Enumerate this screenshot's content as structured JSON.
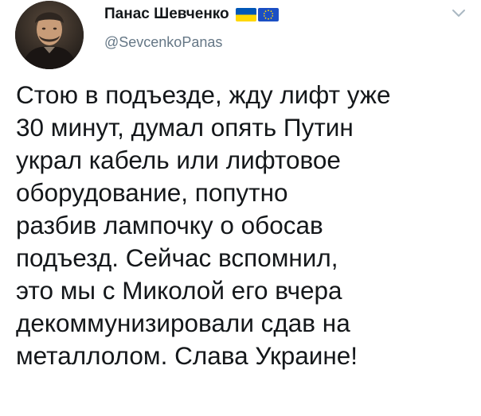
{
  "author": {
    "display_name": "Панас Шевченко",
    "handle": "@SevcenkoPanas",
    "flag_icons": [
      "ukraine-flag-icon",
      "eu-flag-icon"
    ],
    "avatar_icon": "portrait-avatar"
  },
  "tweet": {
    "text": "Стою в подъезде, жду лифт уже\n30 минут, думал опять Путин\nукрал кабель или лифтовое\nоборудование, попутно\nразбив лампочку о обосав\nподъезд. Сейчас вспомнил,\nэто мы с Миколой его вчера\nдекоммунизировали сдав на\nметаллолом. Слава Украине!"
  },
  "menu": {
    "icon": "chevron-down-icon"
  },
  "colors": {
    "text": "#14171a",
    "muted": "#657786",
    "chevron": "#aab8c2",
    "ukraine_blue": "#0057b7",
    "ukraine_yellow": "#ffd700",
    "eu_blue": "#1b4fc4",
    "eu_stars": "#ffd700"
  }
}
